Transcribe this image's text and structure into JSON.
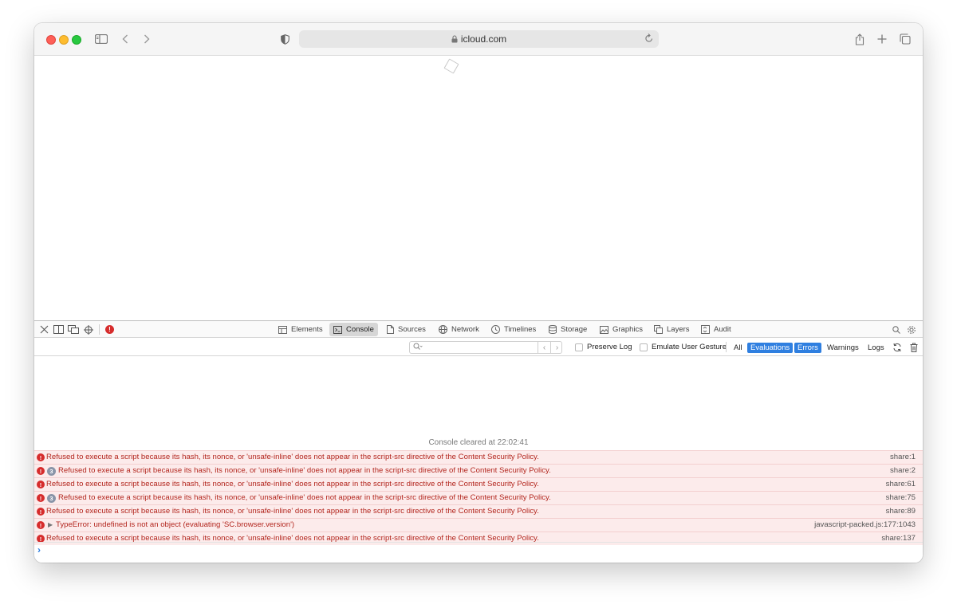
{
  "browser": {
    "url": "icloud.com"
  },
  "inspector": {
    "tabs": [
      {
        "label": "Elements",
        "icon": "elements-icon"
      },
      {
        "label": "Console",
        "icon": "console-icon",
        "active": true
      },
      {
        "label": "Sources",
        "icon": "sources-icon"
      },
      {
        "label": "Network",
        "icon": "network-icon"
      },
      {
        "label": "Timelines",
        "icon": "timelines-icon"
      },
      {
        "label": "Storage",
        "icon": "storage-icon"
      },
      {
        "label": "Graphics",
        "icon": "graphics-icon"
      },
      {
        "label": "Layers",
        "icon": "layers-icon"
      },
      {
        "label": "Audit",
        "icon": "audit-icon"
      }
    ],
    "error_badge": "!"
  },
  "filter": {
    "search_placeholder": "",
    "preserve_log": "Preserve Log",
    "emulate_user_gesture": "Emulate User Gesture",
    "levels": [
      {
        "label": "All",
        "on": false
      },
      {
        "label": "Evaluations",
        "on": true
      },
      {
        "label": "Errors",
        "on": true
      },
      {
        "label": "Warnings",
        "on": false
      },
      {
        "label": "Logs",
        "on": false
      }
    ],
    "active_color": "#2f7fe0"
  },
  "console": {
    "cleared": "Console cleared at 22:02:41",
    "messages": [
      {
        "count": "",
        "expandable": false,
        "text": "Refused to execute a script because its hash, its nonce, or 'unsafe-inline' does not appear in the script-src directive of the Content Security Policy.",
        "location": "share:1"
      },
      {
        "count": "3",
        "expandable": false,
        "text": "Refused to execute a script because its hash, its nonce, or 'unsafe-inline' does not appear in the script-src directive of the Content Security Policy.",
        "location": "share:2"
      },
      {
        "count": "",
        "expandable": false,
        "text": "Refused to execute a script because its hash, its nonce, or 'unsafe-inline' does not appear in the script-src directive of the Content Security Policy.",
        "location": "share:61"
      },
      {
        "count": "3",
        "expandable": false,
        "text": "Refused to execute a script because its hash, its nonce, or 'unsafe-inline' does not appear in the script-src directive of the Content Security Policy.",
        "location": "share:75"
      },
      {
        "count": "",
        "expandable": false,
        "text": "Refused to execute a script because its hash, its nonce, or 'unsafe-inline' does not appear in the script-src directive of the Content Security Policy.",
        "location": "share:89"
      },
      {
        "count": "",
        "expandable": true,
        "text": "TypeError: undefined is not an object (evaluating 'SC.browser.version')",
        "location": "javascript-packed.js:177:1043"
      },
      {
        "count": "",
        "expandable": false,
        "text": "Refused to execute a script because its hash, its nonce, or 'unsafe-inline' does not appear in the script-src directive of the Content Security Policy.",
        "location": "share:137"
      }
    ],
    "error_color": "#b3261e",
    "error_bg": "#fcebeb"
  }
}
